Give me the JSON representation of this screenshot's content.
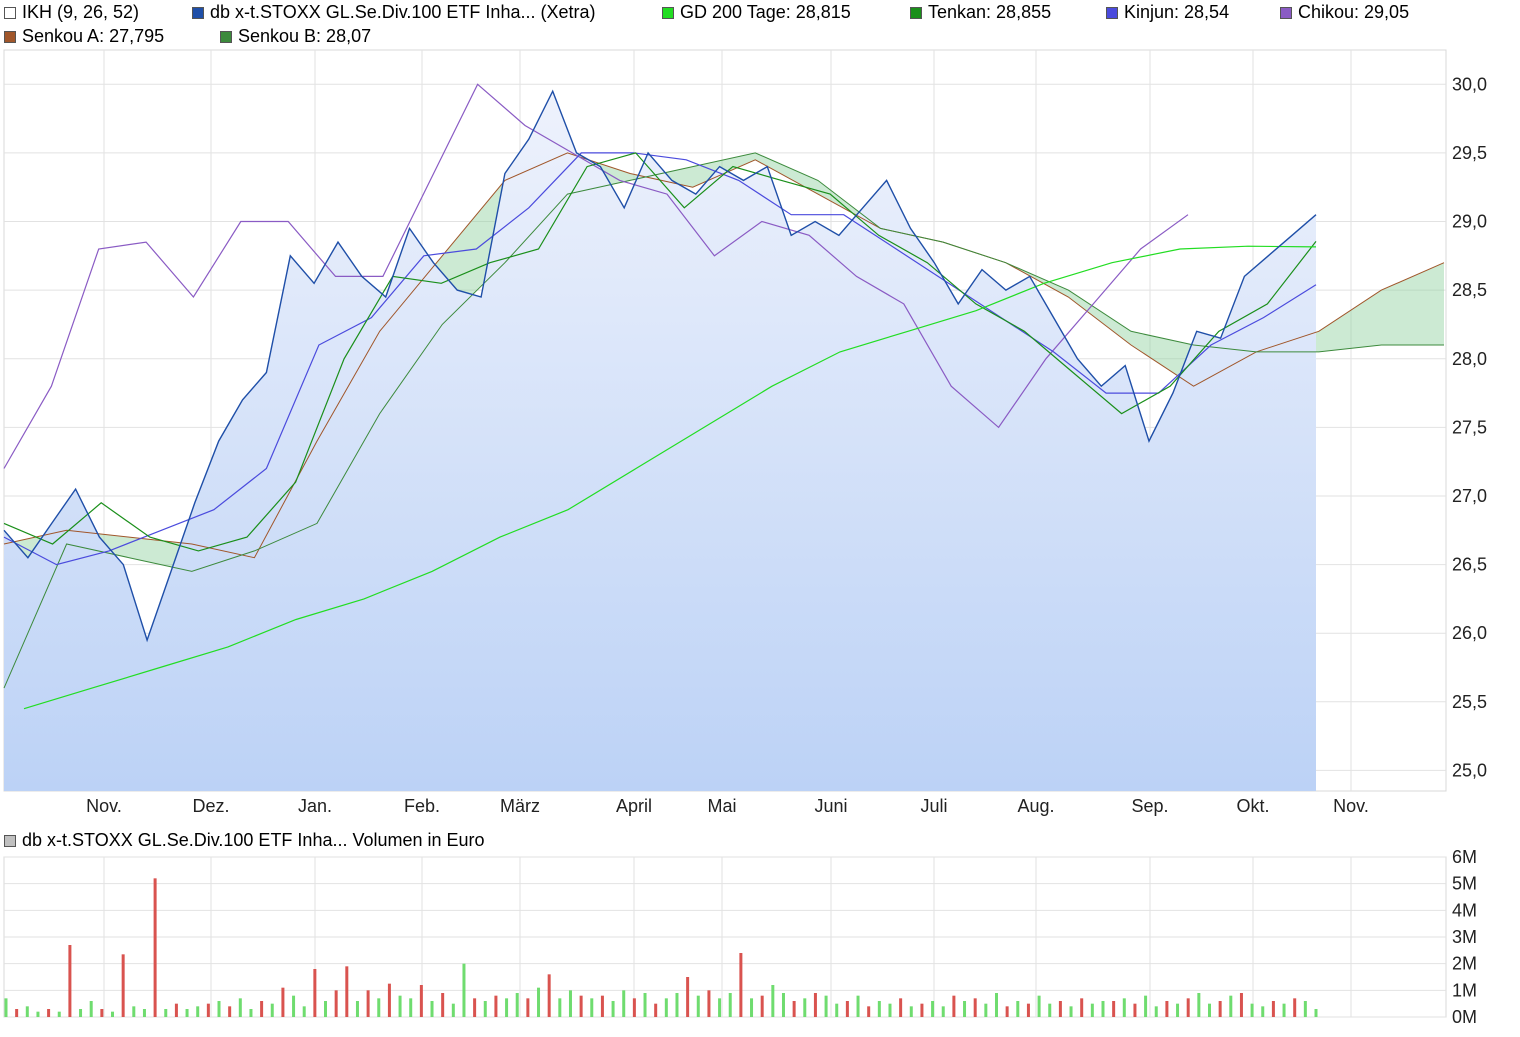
{
  "legend_row1": [
    {
      "label": "IKH (9, 26, 52)",
      "color": "#ffffff"
    },
    {
      "label": "db x-t.STOXX GL.Se.Div.100 ETF Inha... (Xetra)",
      "color": "#1f4fa8"
    },
    {
      "label": "GD 200 Tage: 28,815",
      "color": "#22dd22"
    },
    {
      "label": "Tenkan: 28,855",
      "color": "#1a8f1a"
    },
    {
      "label": "Kinjun: 28,54",
      "color": "#4b4bdd"
    },
    {
      "label": "Chikou: 29,05",
      "color": "#8a5bc4"
    }
  ],
  "legend_row2": [
    {
      "label": "Senkou A: 27,795",
      "color": "#a0562a"
    },
    {
      "label": "Senkou B: 28,07",
      "color": "#3c8a3c"
    }
  ],
  "volume_legend": {
    "label": "db x-t.STOXX GL.Se.Div.100 ETF Inha... Volumen in Euro",
    "color": "#c0c0c0"
  },
  "chart_data": [
    {
      "type": "line",
      "title": "",
      "months": [
        "Nov.",
        "Dez.",
        "Jan.",
        "Feb.",
        "März",
        "April",
        "Mai",
        "Juni",
        "Juli",
        "Aug.",
        "Sep.",
        "Okt.",
        "Nov."
      ],
      "ylim": [
        25.0,
        30.0
      ],
      "y_ticks": [
        "30,0",
        "29,5",
        "29,0",
        "28,5",
        "28,0",
        "27,5",
        "27,0",
        "26,5",
        "26,0",
        "25,5",
        "25,0"
      ],
      "series": [
        {
          "name": "db x-t.STOXX GL.Se.Div.100 ETF Inha... (Xetra)",
          "color": "#1f4fa8",
          "values": [
            26.75,
            26.55,
            26.8,
            27.05,
            26.7,
            26.5,
            25.95,
            26.45,
            26.95,
            27.4,
            27.7,
            27.9,
            28.75,
            28.55,
            28.85,
            28.6,
            28.45,
            28.95,
            28.7,
            28.5,
            28.45,
            29.35,
            29.6,
            29.95,
            29.5,
            29.4,
            29.1,
            29.5,
            29.3,
            29.2,
            29.4,
            29.3,
            29.4,
            28.9,
            29.0,
            28.9,
            29.1,
            29.3,
            28.95,
            28.7,
            28.4,
            28.65,
            28.5,
            28.6,
            28.3,
            28.0,
            27.8,
            27.95,
            27.4,
            27.75,
            28.2,
            28.15,
            28.6,
            28.75,
            28.9,
            29.05
          ]
        },
        {
          "name": "GD 200 Tage",
          "color": "#22dd22",
          "values": [
            25.45,
            25.6,
            25.75,
            25.9,
            26.1,
            26.25,
            26.45,
            26.7,
            26.9,
            27.2,
            27.5,
            27.8,
            28.05,
            28.2,
            28.35,
            28.55,
            28.7,
            28.8,
            28.82,
            28.815
          ]
        },
        {
          "name": "Tenkan",
          "color": "#1a8f1a",
          "values": [
            26.8,
            26.65,
            26.95,
            26.7,
            26.6,
            26.7,
            27.1,
            28.0,
            28.6,
            28.55,
            28.7,
            28.8,
            29.4,
            29.5,
            29.1,
            29.4,
            29.3,
            29.2,
            28.9,
            28.7,
            28.4,
            28.2,
            27.9,
            27.6,
            27.8,
            28.2,
            28.4,
            28.855
          ]
        },
        {
          "name": "Kinjun",
          "color": "#4b4bdd",
          "values": [
            26.7,
            26.5,
            26.6,
            26.75,
            26.9,
            27.2,
            28.1,
            28.3,
            28.75,
            28.8,
            29.1,
            29.5,
            29.5,
            29.45,
            29.3,
            29.05,
            29.05,
            28.8,
            28.55,
            28.3,
            28.05,
            27.75,
            27.75,
            28.1,
            28.3,
            28.54
          ]
        },
        {
          "name": "Chikou",
          "color": "#8a5bc4",
          "values": [
            27.2,
            27.8,
            28.8,
            28.85,
            28.45,
            29.0,
            29.0,
            28.6,
            28.6,
            29.3,
            30.0,
            29.7,
            29.5,
            29.3,
            29.2,
            28.75,
            29.0,
            28.9,
            28.6,
            28.4,
            27.8,
            27.5,
            28.0,
            28.4,
            28.8,
            29.05
          ]
        },
        {
          "name": "Senkou A",
          "color": "#a0562a",
          "values": [
            26.65,
            26.75,
            26.7,
            26.65,
            26.55,
            27.4,
            28.2,
            28.75,
            29.3,
            29.5,
            29.35,
            29.25,
            29.45,
            29.2,
            28.95,
            28.85,
            28.7,
            28.45,
            28.1,
            27.8,
            28.05,
            28.2,
            28.5,
            28.7
          ]
        },
        {
          "name": "Senkou B",
          "color": "#3c8a3c",
          "values": [
            25.6,
            26.65,
            26.55,
            26.45,
            26.6,
            26.8,
            27.6,
            28.25,
            28.7,
            29.2,
            29.3,
            29.4,
            29.5,
            29.3,
            28.95,
            28.85,
            28.7,
            28.5,
            28.2,
            28.1,
            28.05,
            28.05,
            28.1,
            28.1
          ]
        }
      ]
    },
    {
      "type": "bar",
      "title": "",
      "ylim": [
        0,
        6
      ],
      "y_ticks": [
        "6M",
        "5M",
        "4M",
        "3M",
        "2M",
        "1M",
        "0M"
      ],
      "unit": "M Euro",
      "values": [
        0.7,
        0.3,
        0.4,
        0.2,
        0.3,
        0.2,
        2.7,
        0.3,
        0.6,
        0.3,
        0.2,
        2.35,
        0.4,
        0.3,
        5.2,
        0.3,
        0.5,
        0.3,
        0.4,
        0.5,
        0.6,
        0.4,
        0.7,
        0.3,
        0.6,
        0.5,
        1.1,
        0.8,
        0.4,
        1.8,
        0.6,
        1.0,
        1.9,
        0.6,
        1.0,
        0.7,
        1.25,
        0.8,
        0.7,
        1.2,
        0.6,
        0.9,
        0.5,
        2.0,
        0.7,
        0.6,
        0.8,
        0.7,
        0.9,
        0.7,
        1.1,
        1.6,
        0.7,
        1.0,
        0.8,
        0.7,
        0.8,
        0.6,
        1.0,
        0.7,
        0.9,
        0.5,
        0.7,
        0.9,
        1.5,
        0.8,
        1.0,
        0.7,
        0.9,
        2.4,
        0.7,
        0.8,
        1.2,
        0.9,
        0.6,
        0.7,
        0.9,
        0.8,
        0.5,
        0.6,
        0.8,
        0.4,
        0.6,
        0.5,
        0.7,
        0.4,
        0.5,
        0.6,
        0.4,
        0.8,
        0.6,
        0.7,
        0.5,
        0.9,
        0.4,
        0.6,
        0.5,
        0.8,
        0.5,
        0.6,
        0.4,
        0.7,
        0.5,
        0.6,
        0.6,
        0.7,
        0.5,
        0.8,
        0.4,
        0.6,
        0.5,
        0.7,
        0.9,
        0.5,
        0.6,
        0.8,
        0.9,
        0.5,
        0.4,
        0.6,
        0.5,
        0.7,
        0.6,
        0.3
      ],
      "colors": "mixed red/green"
    }
  ]
}
